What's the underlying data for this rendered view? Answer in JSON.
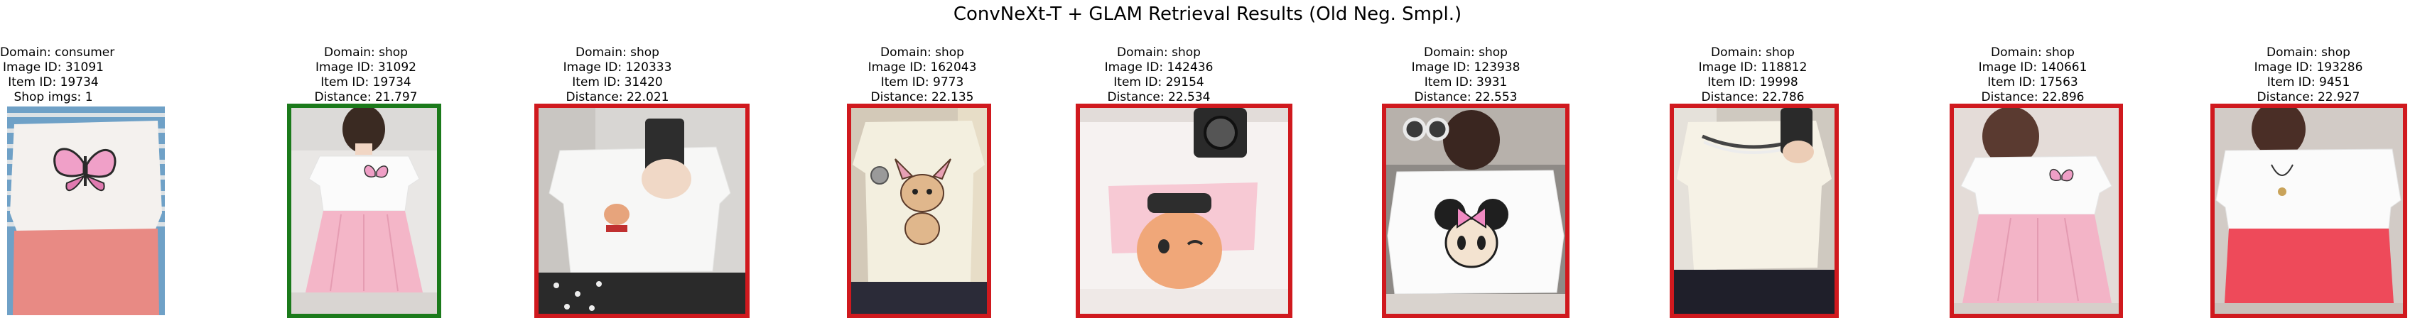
{
  "title": "ConvNeXt-T + GLAM Retrieval Results (Old Neg. Smpl.)",
  "colors": {
    "correct_match": "#1b7a1b",
    "wrong_match": "#d0191e"
  },
  "query": {
    "domain_line": "Domain: consumer",
    "image_id_line": "Image ID: 31091",
    "item_id_line": "Item ID: 19734",
    "extra_line": "Shop imgs: 1",
    "image_description": "white t-shirt with pink butterfly print, pink shorts, blue striped background"
  },
  "results": [
    {
      "domain_line": "Domain: shop",
      "image_id_line": "Image ID: 31092",
      "item_id_line": "Item ID: 19734",
      "distance_line": "Distance: 21.797",
      "match": true,
      "image_description": "white t-shirt with butterfly print and pink pleated skirt"
    },
    {
      "domain_line": "Domain: shop",
      "image_id_line": "Image ID: 120333",
      "item_id_line": "Item ID: 31420",
      "distance_line": "Distance: 22.021",
      "match": false,
      "image_description": "white t-shirt with small print, mirror selfie"
    },
    {
      "domain_line": "Domain: shop",
      "image_id_line": "Image ID: 162043",
      "item_id_line": "Item ID: 9773",
      "distance_line": "Distance: 22.135",
      "match": false,
      "image_description": "cream t-shirt with cartoon deer print"
    },
    {
      "domain_line": "Domain: shop",
      "image_id_line": "Image ID: 142436",
      "item_id_line": "Item ID: 29154",
      "distance_line": "Distance: 22.534",
      "match": false,
      "image_description": "white mesh top with cartoon cat print, camera selfie"
    },
    {
      "domain_line": "Domain: shop",
      "image_id_line": "Image ID: 123938",
      "item_id_line": "Item ID: 3931",
      "distance_line": "Distance: 22.553",
      "match": false,
      "image_description": "white sweatshirt with Minnie Mouse print"
    },
    {
      "domain_line": "Domain: shop",
      "image_id_line": "Image ID: 118812",
      "item_id_line": "Item ID: 19998",
      "distance_line": "Distance: 22.786",
      "match": false,
      "image_description": "cream t-shirt with striped collar, mirror selfie"
    },
    {
      "domain_line": "Domain: shop",
      "image_id_line": "Image ID: 140661",
      "item_id_line": "Item ID: 17563",
      "distance_line": "Distance: 22.896",
      "match": false,
      "image_description": "white t-shirt with butterfly print and pink skirt"
    },
    {
      "domain_line": "Domain: shop",
      "image_id_line": "Image ID: 193286",
      "item_id_line": "Item ID: 9451",
      "distance_line": "Distance: 22.927",
      "match": false,
      "image_description": "white and coral red color-block top"
    }
  ]
}
